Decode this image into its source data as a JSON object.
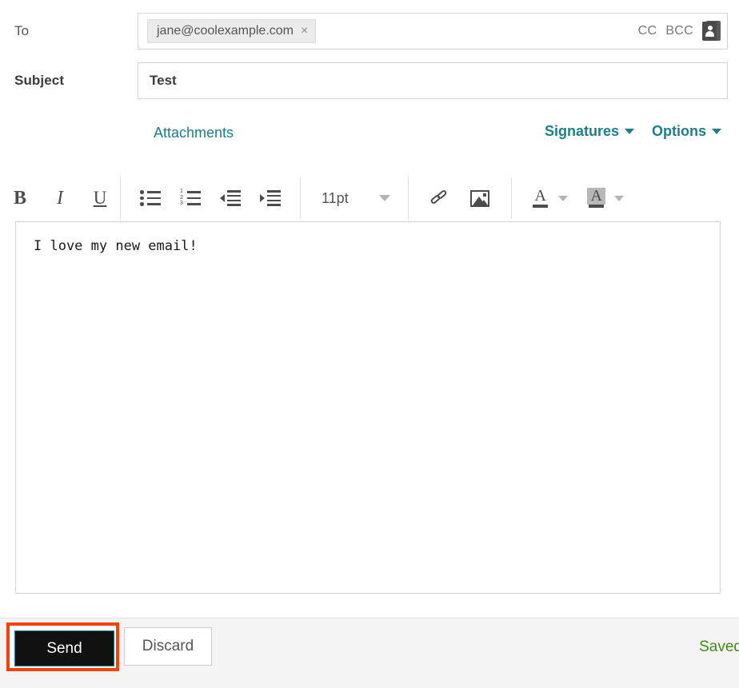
{
  "compose": {
    "to": {
      "label": "To",
      "recipients": [
        {
          "email": "jane@coolexample.com",
          "remove_glyph": "×"
        }
      ],
      "cc_label": "CC",
      "bcc_label": "BCC",
      "contacts_icon": "contacts-book-icon"
    },
    "subject": {
      "label": "Subject",
      "value": "Test"
    },
    "links": {
      "attachments": "Attachments",
      "signatures": "Signatures",
      "options": "Options",
      "caret_glyph": "▾"
    },
    "toolbar": {
      "bold": "B",
      "italic": "I",
      "underline": "U",
      "bulleted_list": "bulleted-list-icon",
      "numbered_list": "numbered-list-icon",
      "numbered_digits": [
        "1",
        "2",
        "3"
      ],
      "outdent": "outdent-icon",
      "indent": "indent-icon",
      "font_size_value": "11pt",
      "insert_link": "link-icon",
      "insert_image": "image-icon",
      "font_color_letter": "A",
      "highlight_letter": "A"
    },
    "body": {
      "text": "I love my new email!"
    },
    "footer": {
      "send_label": "Send",
      "discard_label": "Discard",
      "status": "Saved"
    },
    "colors": {
      "accent_teal": "#1a7f86",
      "saved_green": "#3f8c14",
      "highlight_red": "#f93e06",
      "send_bg": "#111111"
    }
  }
}
